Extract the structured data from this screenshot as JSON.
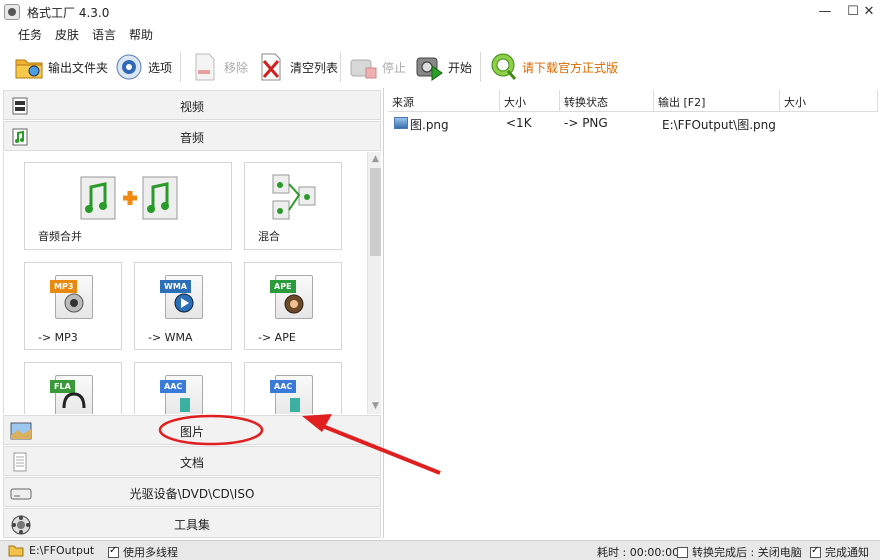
{
  "window": {
    "title": "格式工厂 4.3.0",
    "controls": {
      "minimize": "—",
      "maximize": "☐",
      "close": "✕"
    }
  },
  "menu": [
    "任务",
    "皮肤",
    "语言",
    "帮助"
  ],
  "toolbar": {
    "output_folder": "输出文件夹",
    "options": "选项",
    "remove": "移除",
    "clear_list": "清空列表",
    "stop": "停止",
    "start": "开始",
    "download": "请下载官方正式版"
  },
  "left": {
    "categories_top": [
      {
        "label": "视频",
        "icon": "video-icon"
      },
      {
        "label": "音频",
        "icon": "audio-icon"
      }
    ],
    "tiles": [
      {
        "label": "音频合并",
        "icon": "audio-merge-icon"
      },
      {
        "label": "混合",
        "icon": "mix-icon"
      },
      {
        "label": "-> MP3",
        "icon": "mp3-icon",
        "tag": "MP3"
      },
      {
        "label": "-> WMA",
        "icon": "wma-icon",
        "tag": "WMA"
      },
      {
        "label": "-> APE",
        "icon": "ape-icon",
        "tag": "APE"
      },
      {
        "label": "",
        "icon": "fla-icon",
        "tag": "FLA"
      },
      {
        "label": "",
        "icon": "aac-icon",
        "tag": "AAC"
      },
      {
        "label": "",
        "icon": "aac-icon",
        "tag": "AAC"
      }
    ],
    "categories_bottom": [
      {
        "label": "图片",
        "icon": "picture-icon"
      },
      {
        "label": "文档",
        "icon": "document-icon"
      },
      {
        "label": "光驱设备\\DVD\\CD\\ISO",
        "icon": "disc-drive-icon"
      },
      {
        "label": "工具集",
        "icon": "toolbox-icon"
      }
    ]
  },
  "table": {
    "headers": [
      "来源",
      "大小",
      "转换状态",
      "输出 [F2]",
      "大小"
    ],
    "rows": [
      {
        "source": "图.png",
        "size": "<1K",
        "status": "-> PNG",
        "output": "E:\\FFOutput\\图.png",
        "out_size": ""
      }
    ]
  },
  "status": {
    "output_path": "E:\\FFOutput",
    "multithread": "使用多线程",
    "elapsed": "耗时 : 00:00:00",
    "after_done": "转换完成后 : 关闭电脑",
    "notify": "完成通知",
    "multithread_checked": true,
    "after_done_checked": false,
    "notify_checked": true
  },
  "colors": {
    "annotation": "#e02020",
    "accent_orange": "#d86a00"
  }
}
